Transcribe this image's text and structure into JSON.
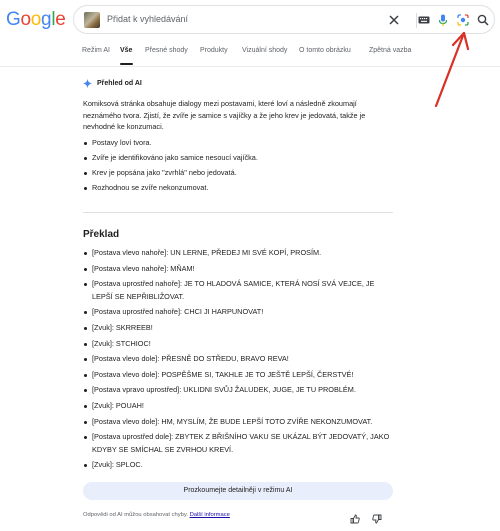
{
  "logo": {
    "text": "Google",
    "letters": [
      "G",
      "o",
      "o",
      "g",
      "l",
      "e"
    ],
    "colors": [
      "#4285F4",
      "#EA4335",
      "#FBBC05",
      "#4285F4",
      "#34A853",
      "#EA4335"
    ]
  },
  "search": {
    "placeholder": "Přidat k vyhledávání",
    "icons": [
      "clear-icon",
      "keyboard-icon",
      "microphone-icon",
      "lens-icon",
      "search-icon"
    ]
  },
  "tabs": [
    "Režim AI",
    "Vše",
    "Přesné shody",
    "Produkty",
    "Vizuální shody",
    "O tomto obrázku",
    "Zpětná vazba"
  ],
  "active_tab": "Vše",
  "ai_overview": {
    "title": "Přehled od AI",
    "summary": "Komiksová stránka obsahuje dialogy mezi postavami, které loví a následně zkoumají neznámého tvora. Zjistí, že zvíře je samice s vajíčky a že jeho krev je jedovatá, takže je nevhodné ke konzumaci.",
    "points": [
      "Postavy loví tvora.",
      "Zvíře je identifikováno jako samice nesoucí vajíčka.",
      "Krev je popsána jako \"zvrhlá\" nebo jedovatá.",
      "Rozhodnou se zvíře nekonzumovat."
    ]
  },
  "translation": {
    "heading": "Překlad",
    "lines": [
      "[Postava vlevo nahoře]: UN LERNE, PŘEDEJ MI SVÉ KOPÍ, PROSÍM.",
      "[Postava vlevo nahoře]: MŇAM!",
      "[Postava uprostřed nahoře]: JE TO HLADOVÁ SAMICE, KTERÁ NOSÍ SVÁ VEJCE, JE LEPŠÍ SE NEPŘIBLIŽOVAT.",
      "[Postava uprostřed nahoře]: CHCI JI HARPUNOVAT!",
      "[Zvuk]: SKRREEB!",
      "[Zvuk]: STCHIOC!",
      "[Postava vlevo dole]: PŘESNĚ DO STŘEDU, BRAVO REVA!",
      "[Postava vlevo dole]: POSPĚŠME SI, TAKHLE JE TO JEŠTĚ LEPŠÍ, ČERSTVÉ!",
      "[Postava vpravo uprostřed]: UKLIDNI SVŮJ ŽALUDEK, JUGE, JE TU PROBLÉM.",
      "[Zvuk]: POUAH!",
      "[Postava vlevo dole]: HM, MYSLÍM, ŽE BUDE LEPŠÍ TOTO ZVÍŘE NEKONZUMOVAT.",
      "[Postava uprostřed dole]: ZBYTEK Z BŘIŠNÍHO VAKU SE UKÁZAL BÝT JEDOVATÝ, JAKO KDYBY SE SMÍCHAL SE ZVRHOU KREVÍ.",
      "[Zvuk]: SPLOC."
    ]
  },
  "explore_button": "Prozkoumejte detailněji v režimu AI",
  "footer": {
    "note": "Odpovědi od AI můžou obsahovat chyby.",
    "link": "Další informace",
    "icons": [
      "thumbs-up-icon",
      "thumbs-down-icon"
    ]
  },
  "annotation_color": "#d93025"
}
